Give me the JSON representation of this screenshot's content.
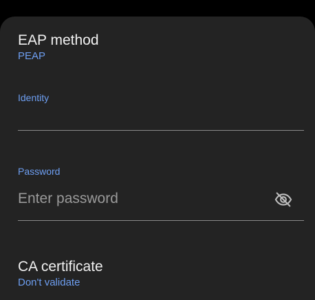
{
  "eap_method": {
    "title": "EAP method",
    "value": "PEAP"
  },
  "identity": {
    "label": "Identity",
    "value": "",
    "placeholder": ""
  },
  "password": {
    "label": "Password",
    "value": "",
    "placeholder": "Enter password",
    "visibility_icon": "eye-off-icon"
  },
  "ca_certificate": {
    "title": "CA certificate",
    "value": "Don't validate"
  },
  "colors": {
    "accent": "#6e9ff2",
    "background": "#232323",
    "text_primary": "#f1f1f1",
    "divider": "#8a8a8a"
  }
}
